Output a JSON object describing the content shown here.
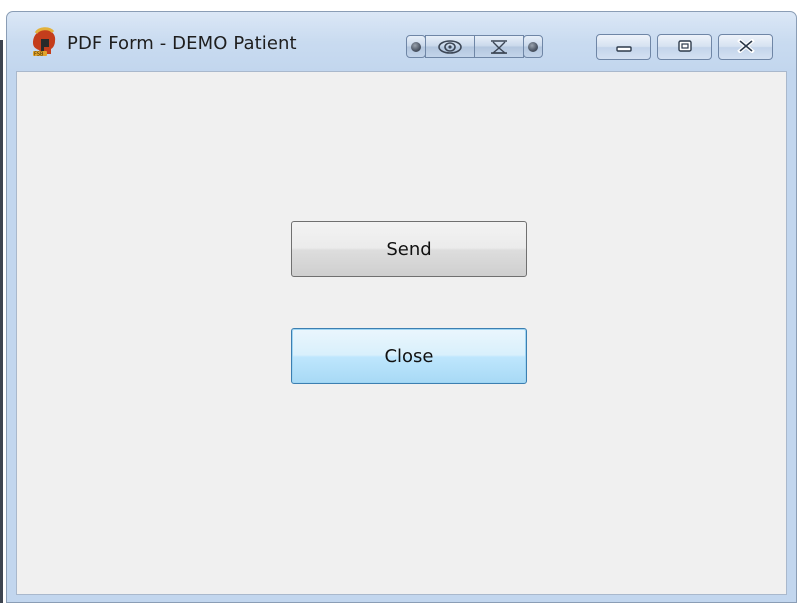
{
  "window": {
    "title": "PDF Form - DEMO Patient",
    "app_icon": "spartan-helmet-icon"
  },
  "titlebar_tools": {
    "icons": [
      "record-dot-icon",
      "eye-icon",
      "hourglass-icon",
      "record-dot-icon"
    ]
  },
  "window_controls": {
    "minimize_icon": "minimize-icon",
    "maximize_icon": "maximize-icon",
    "close_icon": "close-icon"
  },
  "content": {
    "send_label": "Send",
    "close_label": "Close"
  },
  "colors": {
    "client_background": "#f0f0f0",
    "focused_button": "#bee6fd",
    "window_frame": "#c2d6ee"
  }
}
